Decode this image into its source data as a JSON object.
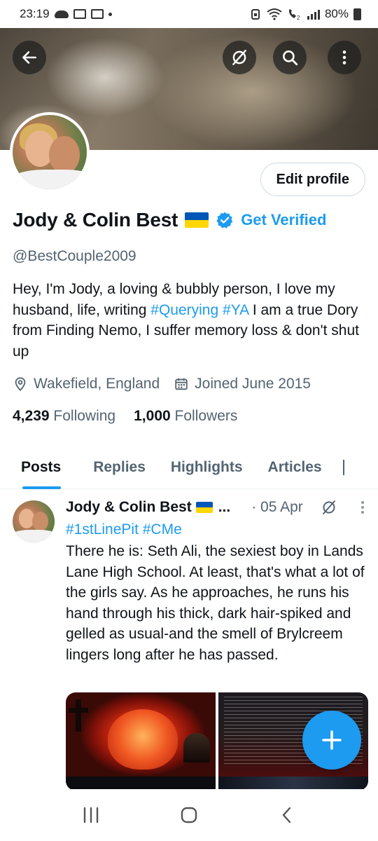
{
  "status_bar": {
    "time": "23:19",
    "battery": "80%"
  },
  "profile": {
    "edit_label": "Edit profile",
    "name": "Jody & Colin Best",
    "get_verified": "Get Verified",
    "handle": "@BestCouple2009",
    "bio": {
      "text1": "Hey, I'm Jody, a loving & bubbly person, I love my husband, life, writing ",
      "tag1": "#Querying",
      "sep": " ",
      "tag2": "#YA",
      "text2": " I am a true Dory from Finding Nemo, I suffer memory loss & don't shut up"
    },
    "location": "Wakefield, England",
    "joined": "Joined June 2015",
    "following_count": "4,239",
    "following_label": "Following",
    "followers_count": "1,000",
    "followers_label": "Followers"
  },
  "tabs": [
    "Posts",
    "Replies",
    "Highlights",
    "Articles"
  ],
  "post": {
    "author": "Jody & Colin Best",
    "ellipsis": "...",
    "date": "· 05 Apr",
    "tags": "#1stLinePit #CMe",
    "text": "There he is: Seth Ali, the sexiest boy in Lands Lane High School. At least, that's what a lot of the girls say. As he approaches, he runs his hand through his thick, dark hair-spiked and gelled as usual-and the smell of Brylcreem lingers long after he has passed."
  },
  "colors": {
    "accent": "#1d9bf0",
    "text": "#0f1419",
    "muted": "#536471",
    "flag_blue": "#0057b7",
    "flag_yellow": "#ffd700"
  },
  "icons": [
    "back-arrow-icon",
    "no-notifications-icon",
    "search-icon",
    "more-vertical-icon",
    "verified-badge-icon",
    "location-pin-icon",
    "calendar-icon",
    "compose-plus-icon"
  ]
}
